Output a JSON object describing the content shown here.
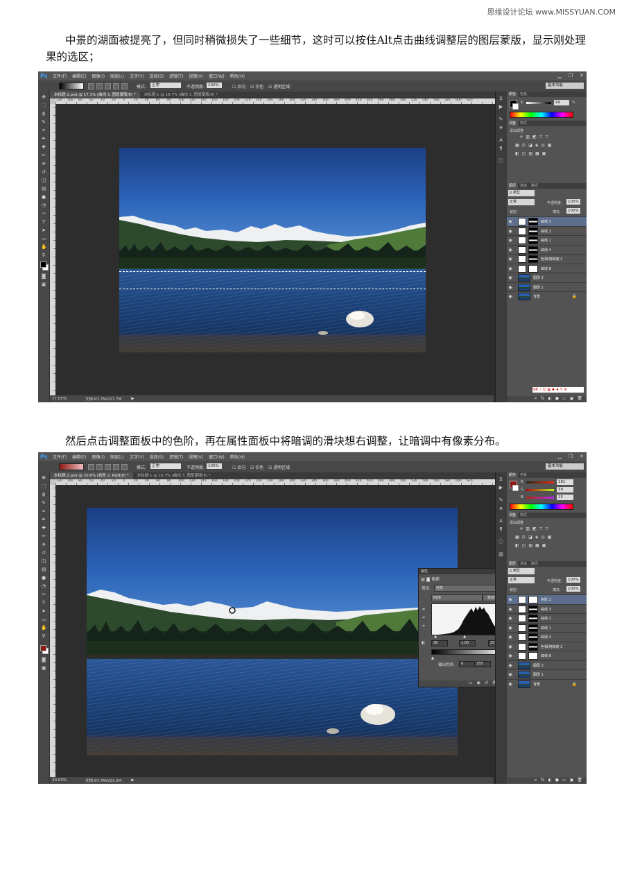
{
  "watermark": "思缘设计论坛 www.MISSYUAN.COM",
  "paragraphs": {
    "p1": "中景的湖面被提亮了，但同时稍微损失了一些细节，这时可以按住Alt点击曲线调整层的图层蒙版，显示刚处理果的选区；",
    "p2": "然后点击调整面板中的色阶，再在属性面板中将暗调的滑块想右调整，让暗调中有像素分布。"
  },
  "ps": {
    "logo": "Ps",
    "menu": [
      "文件(F)",
      "编辑(E)",
      "图像(I)",
      "图层(L)",
      "文字(Y)",
      "选择(S)",
      "滤镜(T)",
      "视图(V)",
      "窗口(W)",
      "帮助(H)"
    ],
    "window_controls": [
      "▁",
      "❐",
      "✕"
    ],
    "options": {
      "mode_label": "模式:",
      "mode_value": "正常",
      "opacity_label": "不透明度:",
      "opacity_value": "100%",
      "reverse": "反向",
      "dither": "仿色",
      "transparency": "透明区域",
      "workspace": "基本功能"
    },
    "ruler_marks": [
      "120",
      "100",
      "80",
      "60",
      "40",
      "20",
      "0",
      "20",
      "40",
      "60",
      "80",
      "100",
      "120",
      "140",
      "160",
      "180",
      "200",
      "220",
      "240",
      "260",
      "280",
      "300",
      "320",
      "340",
      "360",
      "380",
      "400",
      "420",
      "440",
      "460",
      "480",
      "500",
      "520",
      "540",
      "560",
      "580",
      "600",
      "620"
    ],
    "color_tabs": [
      "颜色",
      "色板"
    ],
    "adjust_tabs": [
      "调整",
      "样式"
    ],
    "adjust_title": "添加调整",
    "adjust_rows": [
      [
        "☀",
        "▥",
        "◩",
        "▽",
        "▽"
      ],
      [
        "▦",
        "⚖",
        "◪",
        "◈",
        "◎",
        "▦"
      ],
      [
        "◧",
        "◫",
        "▨",
        "▩",
        "▣"
      ]
    ],
    "layers_tabs": [
      "图层",
      "通道",
      "路径"
    ],
    "layers_kind": "ρ 类型",
    "blend_mode": "正常",
    "opacity_label": "不透明度:",
    "opacity_value": "100%",
    "lock_label": "锁定:",
    "fill_label": "填充:",
    "fill_value": "100%",
    "footer_icons": [
      "∞",
      "fx",
      "◐",
      "●",
      "▭",
      "▣",
      "🗑"
    ],
    "ime_text": "S中 ♪ ☺ ▦ ♣ ♦ ✎ ⚙"
  },
  "screen1": {
    "tabs": [
      "未标题-2.psd @ 17.1% (曲线 3, 图层蒙版/8) *",
      "未标题-1 @ 16.7% (曲线 3, 图层蒙版/8) *"
    ],
    "zoom": "17.05%",
    "doc": "文档:97.7M/217.7M",
    "fg_color": "#000000",
    "k_label": "K",
    "k_value": "99",
    "k_unit": "%",
    "layers": [
      {
        "name": "曲线 3",
        "mask": "black",
        "selected": true
      },
      {
        "name": "曲线 2",
        "mask": "black",
        "selected": false
      },
      {
        "name": "曲线 1",
        "mask": "black",
        "selected": false
      },
      {
        "name": "曲线 4",
        "mask": "black",
        "selected": false
      },
      {
        "name": "色相/饱和度 2",
        "mask": "black",
        "selected": false
      },
      {
        "name": "曲线 8",
        "mask": "white",
        "selected": false
      },
      {
        "name": "图层 2",
        "mask": "none",
        "selected": false,
        "photo": true
      },
      {
        "name": "图层 1",
        "mask": "none",
        "selected": false,
        "photo": true
      },
      {
        "name": "背景",
        "mask": "none",
        "selected": false,
        "photo": true,
        "locked": true
      }
    ]
  },
  "screen2": {
    "tabs": [
      "未标题-2.psd @ 20.6% (色阶 2, RGB/8) *",
      "未标题-1 @ 16.7% (曲线 3, 图层蒙版/8) *"
    ],
    "zoom": "20.03%",
    "doc": "文档:97.7M/221.5M",
    "fg_color": "#8b1a12",
    "r_label": "R",
    "r_value": "181",
    "g_label": "G",
    "g_value": "39",
    "b_label": "B",
    "b_value": "15",
    "properties": {
      "header": "属性",
      "title": "色阶",
      "preset_label": "预设:",
      "preset_value": "自定",
      "channel": "RGB",
      "auto_btn": "自动",
      "input_black": "36",
      "input_gamma": "1.00",
      "input_white": "255",
      "output_label": "输出色阶:",
      "output_black": "0",
      "output_white": "255"
    },
    "layers": [
      {
        "name": "色阶 2",
        "mask": "white",
        "selected": true
      },
      {
        "name": "曲线 3",
        "mask": "black",
        "selected": false
      },
      {
        "name": "曲线 2",
        "mask": "black",
        "selected": false
      },
      {
        "name": "曲线 1",
        "mask": "black",
        "selected": false
      },
      {
        "name": "曲线 4",
        "mask": "black",
        "selected": false
      },
      {
        "name": "色相/饱和度 2",
        "mask": "black",
        "selected": false
      },
      {
        "name": "曲线 8",
        "mask": "white",
        "selected": false
      },
      {
        "name": "图层 2",
        "mask": "none",
        "selected": false,
        "photo": true
      },
      {
        "name": "图层 1",
        "mask": "none",
        "selected": false,
        "photo": true
      },
      {
        "name": "背景",
        "mask": "none",
        "selected": false,
        "photo": true,
        "locked": true
      }
    ]
  }
}
